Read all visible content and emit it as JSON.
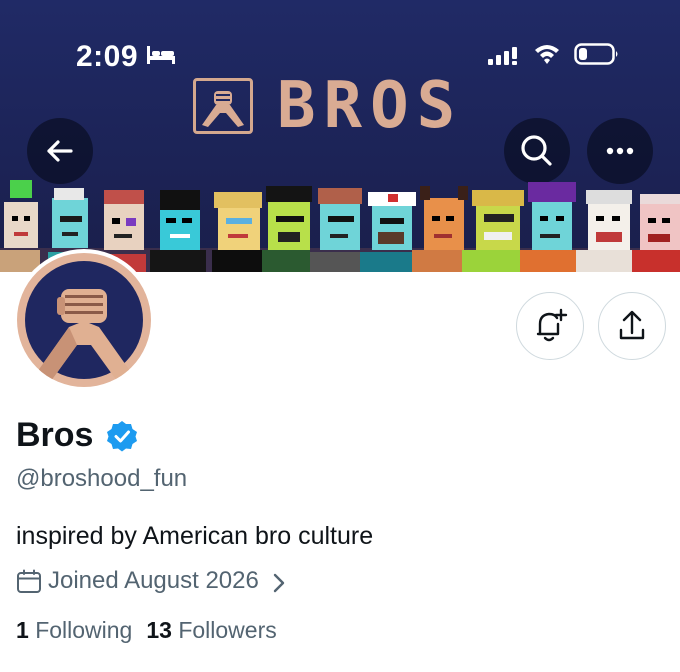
{
  "status_bar": {
    "time": "2:09",
    "icons": [
      "bed-icon",
      "cellular-signal-icon",
      "wifi-icon",
      "battery-icon"
    ]
  },
  "banner": {
    "brand_text": "BROS",
    "emblem_icon": "arm-wrestle-handshake-icon",
    "background_color": "#1f2760",
    "accent_color": "#d9ab93"
  },
  "nav": {
    "back_icon": "arrow-left-icon",
    "search_icon": "search-icon",
    "more_icon": "more-horizontal-icon"
  },
  "profile": {
    "display_name": "Bros",
    "verified_icon": "verified-badge-icon",
    "handle": "@broshood_fun",
    "bio": "inspired by American bro culture",
    "joined": "Joined August 2026",
    "following_count": "1",
    "following_label": "Following",
    "followers_count": "13",
    "followers_label": "Followers",
    "verified_color": "#1d9bf0"
  },
  "actions": {
    "notify_icon": "bell-plus-icon",
    "share_icon": "share-icon"
  }
}
